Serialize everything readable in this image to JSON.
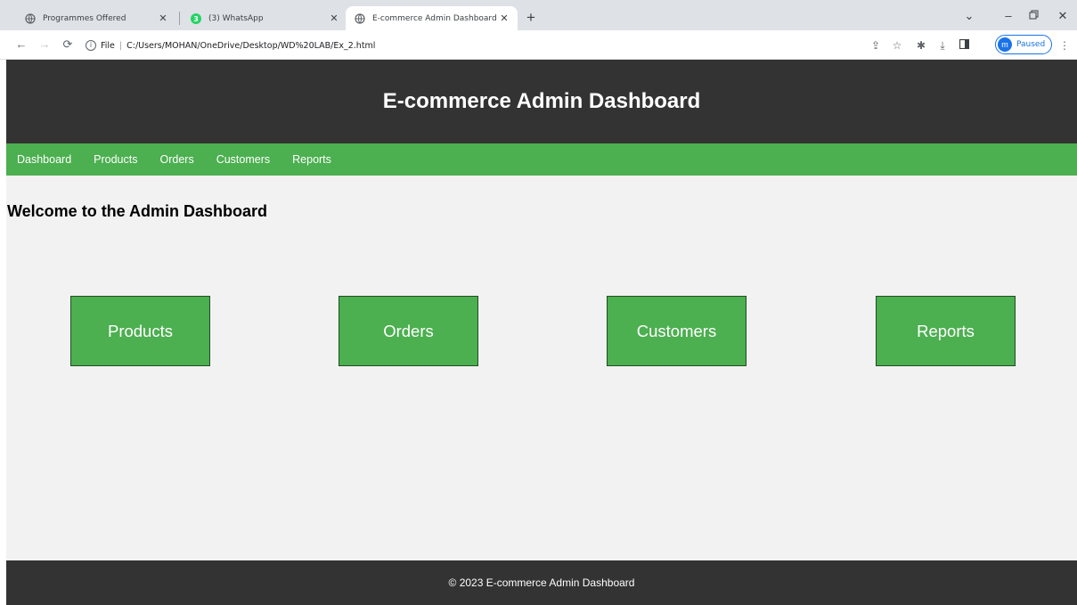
{
  "browser": {
    "tabs": [
      {
        "title": "Programmes Offered"
      },
      {
        "title": "(3) WhatsApp",
        "badge": "3"
      },
      {
        "title": "E-commerce Admin Dashboard",
        "active": true
      }
    ],
    "address": {
      "scheme_label": "File",
      "path": "C:/Users/MOHAN/OneDrive/Desktop/WD%20LAB/Ex_2.html"
    },
    "profile": {
      "initial": "m",
      "status": "Paused"
    }
  },
  "site": {
    "title": "E-commerce Admin Dashboard",
    "nav": [
      "Dashboard",
      "Products",
      "Orders",
      "Customers",
      "Reports"
    ],
    "welcome": "Welcome to the Admin Dashboard",
    "cards": [
      "Products",
      "Orders",
      "Customers",
      "Reports"
    ],
    "footer": "© 2023 E-commerce Admin Dashboard"
  },
  "colors": {
    "header_bg": "#333333",
    "nav_bg": "#4caf50",
    "card_bg": "#4caf50",
    "page_bg": "#f2f2f2",
    "footer_bg": "#333333"
  }
}
